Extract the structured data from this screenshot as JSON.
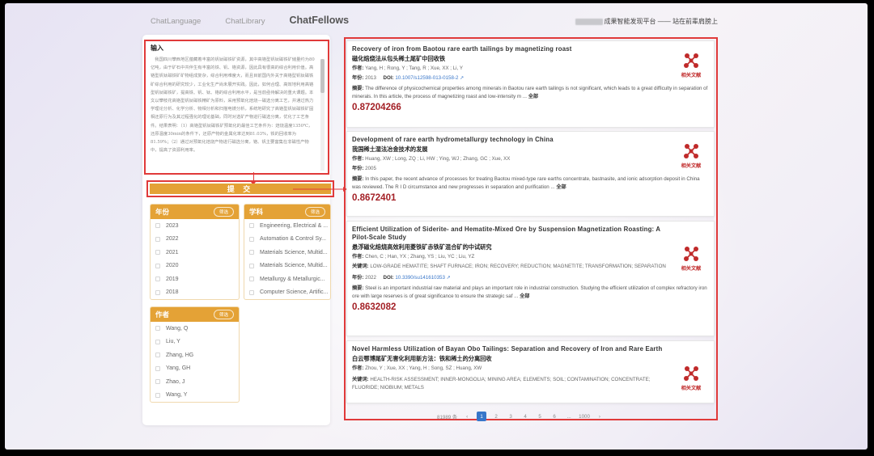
{
  "header": {
    "nav": [
      "ChatLanguage",
      "ChatLibrary",
      "ChatFellows"
    ],
    "platform_text": "成果智能发现平台 —— 站在前辈肩膀上"
  },
  "input": {
    "label": "输入",
    "text": "我国四川攀西地区蕴藏着丰富的钒钛磁铁矿资源，其中高铬型钒钛磁铁矿储量约为80亿吨，由于矿石中共伴生有丰富的铁、钒、铬资源，因此具有很高的综合利用价值。高铬型钒钛磁铁矿矿物组成复杂，综合利用难度大，而且目前国内外关于高铬型钒钛磁铁矿综合利用的研究较少，工业化生产尚未展开实践。因此，如何合理、高效地利用高铬型钒钛磁铁矿，提高铁、钒、钛、铬的综合利用水平，是当前亟待解决的重大课题。本文以攀枝花高铬型钒钛磁铁精矿为原料，采用预氧化焙烧—磁选分离工艺，并通过热力学理论分析、化学分析、物相分析和扫描电镜分析，系统地研究了高铬型钒钛磁铁矿固相还原行为及其过程强化的理论基础，同时对选矿产物进行磁选分离，优化了工艺条件。结果表明：（1）高铬型钒钛磁铁矿预氧化的最佳工艺条件为：焙烧温度1350℃，还原温度30min的条件下，还原产物的金属化率达到81.03%，铁的回收率为81.59%；（2）通过对预氧化焙烧产物进行磁选分离，铬、钒主要富集在非磁性产物中，提高了资源利用率。"
  },
  "submit_label": "提 交",
  "filters": [
    {
      "title": "年份",
      "button": "筛选",
      "items": [
        "2023",
        "2022",
        "2021",
        "2020",
        "2019",
        "2018"
      ]
    },
    {
      "title": "学科",
      "button": "筛选",
      "items": [
        "Engineering, Electrical & ...",
        "Automation & Control Sy...",
        "Materials Science, Multid...",
        "Materials Science, Multid...",
        "Metallurgy & Metallurgic...",
        "Computer Science, Artific..."
      ]
    },
    {
      "title": "作者",
      "button": "筛选",
      "items": [
        "Wang, Q",
        "Liu, Y",
        "Zhang, HG",
        "Yang, GH",
        "Zhao, J",
        "Wang, Y"
      ]
    }
  ],
  "results": [
    {
      "title_en": "Recovery of iron from Baotou rare earth tailings by magnetizing roast",
      "title_zh": "磁化焙烧法从包头稀土尾矿中回收铁",
      "author_label": "作者:",
      "authors": "Yang, H ; Rong, Y ; Tang, R ; Xue, XX ; Li, Y",
      "year_label": "年份:",
      "year": "2013",
      "doi_label": "DOI:",
      "doi": "10.1007/s12598-013-0158-2 ↗",
      "abstract_label": "摘要:",
      "abstract": "The difference of physicochemical properties among minerals in Baotou rare earth tailings is not significant, which leads to a great difficulty in separation of minerals. In this article, the process of magnetizing roast and low-intensity m ...",
      "more": "全部",
      "score": "0.87204266",
      "related": "相关文献"
    },
    {
      "title_en": "Development of rare earth hydrometallurgy technology in China",
      "title_zh": "我国稀土湿法冶金技术的发展",
      "author_label": "作者:",
      "authors": "Huang, XW ; Long, ZQ ; Li, HW ; Ying, WJ ; Zhang, GC ; Xue, XX",
      "year_label": "年份:",
      "year": "2005",
      "abstract_label": "摘要:",
      "abstract": "In this paper, the recent advance of processes for treating Baotou mixed-type rare earths concentrate, bastnasite, and ionic adsorption deposit in China was reviewed. The R I D circumstance and new progresses in separation and purification ...",
      "more": "全部",
      "score": "0.8672401",
      "related": "相关文献"
    },
    {
      "title_en": "Efficient Utilization of Siderite- and Hematite-Mixed Ore by Suspension Magnetization Roasting: A Pilot-Scale Study",
      "title_zh": "悬浮磁化焙烧高效利用菱铁矿赤铁矿混合矿的中试研究",
      "author_label": "作者:",
      "authors": "Chen, C ; Han, YX ; Zhang, YS ; Liu, YC ; Liu, YZ",
      "keywords_label": "关键词:",
      "keywords": "LOW-GRADE HEMATITE; SHAFT FURNACE; IRON; RECOVERY; REDUCTION; MAGNETITE; TRANSFORMATION; SEPARATION",
      "year_label": "年份:",
      "year": "2022",
      "doi_label": "DOI:",
      "doi": "10.3390/su141610353 ↗",
      "abstract_label": "摘要:",
      "abstract": "Steel is an important industrial raw material and plays an important role in industrial construction. Studying the efficient utilization of complex refractory iron ore with large reserves is of great significance to ensure the strategic saf ...",
      "more": "全部",
      "score": "0.8632082",
      "related": "相关文献"
    },
    {
      "title_en": "Novel Harmless Utilization of Bayan Obo Tailings: Separation and Recovery of Iron and Rare Earth",
      "title_zh": "白云鄂博尾矿无害化利用新方法：铁和稀土的分离回收",
      "author_label": "作者:",
      "authors": "Zhou, Y ; Xue, XX ; Yang, H ; Song, SZ ; Huang, XW",
      "keywords_label": "关键词:",
      "keywords": "HEALTH-RISK ASSESSMENT; INNER-MONGOLIA; MINING AREA; ELEMENTS; SOIL; CONTAMINATION; CONCENTRATE; FLUORIDE; NIOBIUM; METALS",
      "related": "相关文献"
    }
  ],
  "pagination": {
    "total": "81989 条",
    "prev": "‹",
    "pages": [
      "1",
      "2",
      "3",
      "4",
      "5",
      "6",
      "...",
      "1000"
    ],
    "next": "›"
  }
}
